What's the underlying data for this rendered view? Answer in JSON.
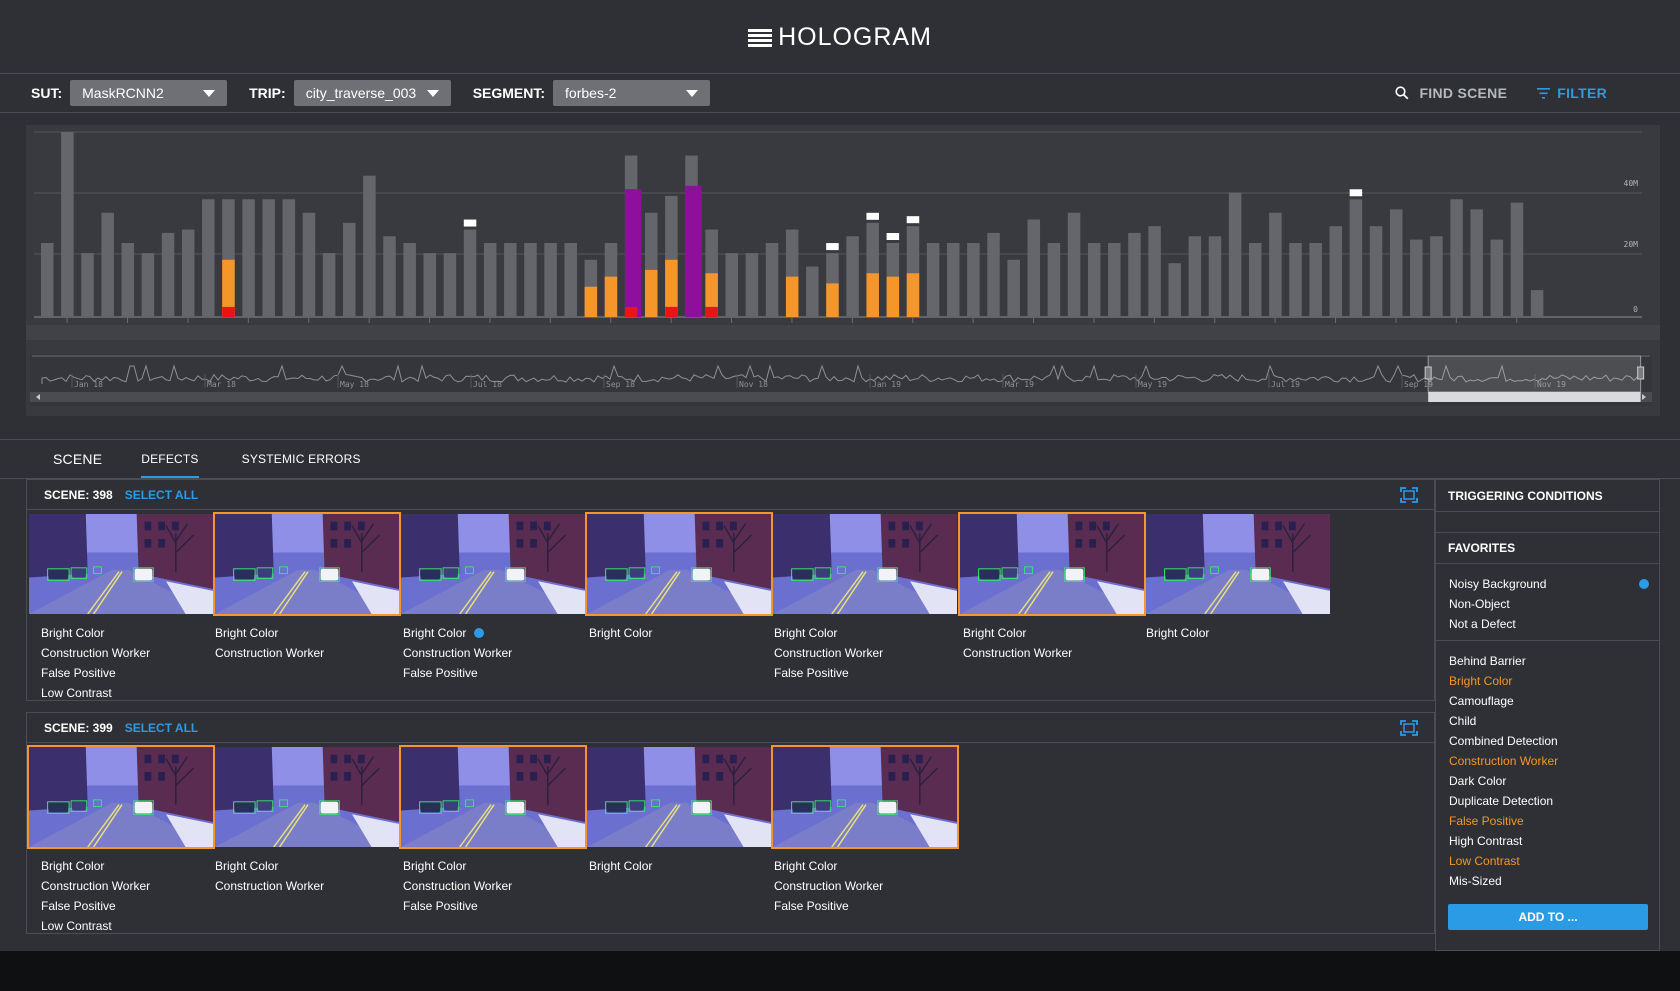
{
  "app": {
    "title": "HOLOGRAM"
  },
  "toolbar": {
    "sut_label": "SUT:",
    "sut_value": "MaskRCNN2",
    "trip_label": "TRIP:",
    "trip_value": "city_traverse_003",
    "segment_label": "SEGMENT:",
    "segment_value": "forbes-2",
    "find_label": "FIND SCENE",
    "filter_label": "FILTER"
  },
  "colors": {
    "accent": "#2b9be6",
    "defect": "#f5962a",
    "critical": "#e8141a",
    "systemic": "#8e0f9c",
    "bar": "#64666b"
  },
  "chart_data": {
    "type": "bar",
    "ylabels": [
      "40M",
      "20M",
      "0"
    ],
    "ylim": [
      0,
      55
    ],
    "series": [
      {
        "name": "total",
        "values": [
          22,
          55,
          19,
          31,
          22,
          19,
          25,
          26,
          35,
          35,
          35,
          35,
          35,
          31,
          19,
          28,
          42,
          24,
          22,
          19,
          19,
          26,
          22,
          22,
          22,
          22,
          22,
          17,
          22,
          48,
          31,
          36,
          48,
          26,
          19,
          19,
          22,
          26,
          15,
          19,
          24,
          28,
          22,
          27,
          22,
          22,
          22,
          25,
          17,
          29,
          22,
          31,
          22,
          22,
          25,
          27,
          16,
          24,
          24,
          37,
          22,
          31,
          22,
          22,
          27,
          35,
          27,
          32,
          23,
          24,
          35,
          32,
          23,
          34,
          8
        ]
      },
      {
        "name": "defect",
        "values": [
          0,
          0,
          0,
          0,
          0,
          0,
          0,
          0,
          0,
          17,
          0,
          0,
          0,
          0,
          0,
          0,
          0,
          0,
          0,
          0,
          0,
          0,
          0,
          0,
          0,
          0,
          0,
          9,
          12,
          0,
          14,
          17,
          0,
          13,
          0,
          0,
          0,
          12,
          0,
          10,
          0,
          13,
          12,
          13,
          0,
          0,
          0,
          0,
          0,
          0,
          0,
          0,
          0,
          0,
          0,
          0,
          0,
          0,
          0,
          0,
          0,
          0,
          0,
          0,
          0,
          0,
          0,
          0,
          0,
          0,
          0,
          0,
          0,
          0,
          0
        ]
      },
      {
        "name": "critical",
        "values": [
          0,
          0,
          0,
          0,
          0,
          0,
          0,
          0,
          0,
          3,
          0,
          0,
          0,
          0,
          0,
          0,
          0,
          0,
          0,
          0,
          0,
          0,
          0,
          0,
          0,
          0,
          0,
          0,
          0,
          3,
          0,
          3,
          0,
          3,
          0,
          0,
          0,
          0,
          0,
          0,
          0,
          0,
          0,
          0,
          0,
          0,
          0,
          0,
          0,
          0,
          0,
          0,
          0,
          0,
          0,
          0,
          0,
          0,
          0,
          0,
          0,
          0,
          0,
          0,
          0,
          0,
          0,
          0,
          0,
          0,
          0,
          0,
          0,
          0,
          0
        ]
      },
      {
        "name": "systemic",
        "values": [
          0,
          0,
          0,
          0,
          0,
          0,
          0,
          0,
          0,
          0,
          0,
          0,
          0,
          0,
          0,
          0,
          0,
          0,
          0,
          0,
          0,
          0,
          0,
          0,
          0,
          0,
          0,
          0,
          0,
          38,
          0,
          0,
          39,
          0,
          0,
          0,
          0,
          0,
          0,
          0,
          0,
          0,
          0,
          0,
          0,
          0,
          0,
          0,
          0,
          0,
          0,
          0,
          0,
          0,
          0,
          0,
          0,
          0,
          0,
          0,
          0,
          0,
          0,
          0,
          0,
          0,
          0,
          0,
          0,
          0,
          0,
          0,
          0,
          0,
          0
        ]
      },
      {
        "name": "flag",
        "values": [
          0,
          0,
          0,
          0,
          0,
          0,
          0,
          0,
          0,
          0,
          0,
          0,
          0,
          0,
          0,
          0,
          0,
          0,
          0,
          0,
          0,
          1,
          0,
          0,
          0,
          0,
          0,
          0,
          0,
          0,
          0,
          0,
          0,
          0,
          0,
          0,
          0,
          0,
          0,
          1,
          0,
          1,
          1,
          1,
          0,
          0,
          0,
          0,
          0,
          0,
          0,
          0,
          0,
          0,
          0,
          0,
          0,
          0,
          0,
          0,
          0,
          0,
          0,
          0,
          0,
          1,
          0,
          0,
          0,
          0,
          0,
          0,
          0,
          0,
          0
        ]
      }
    ],
    "timeline_labels": [
      "Jan 18",
      "Mar 18",
      "May 18",
      "Jul 18",
      "Sep 18",
      "Nov 18",
      "Jan 19",
      "Mar 19",
      "May 19",
      "Jul 19",
      "Sep 19",
      "Nov 19"
    ],
    "selection_range": [
      0.862,
      0.993
    ]
  },
  "tabs": [
    "SCENE",
    "DEFECTS",
    "SYSTEMIC ERRORS"
  ],
  "scenes": [
    {
      "title": "SCENE: 398",
      "select_all": "SELECT ALL",
      "thumbs": [
        {
          "selected": false,
          "tags": [
            "Bright Color",
            "Construction Worker",
            "False Positive",
            "Low Contrast"
          ]
        },
        {
          "selected": true,
          "tags": [
            "Bright Color",
            "Construction Worker"
          ]
        },
        {
          "selected": false,
          "tags": [
            "Bright Color",
            "Construction Worker",
            "False Positive"
          ],
          "favorite_dot": true
        },
        {
          "selected": true,
          "tags": [
            "Bright Color"
          ]
        },
        {
          "selected": false,
          "tags": [
            "Bright Color",
            "Construction Worker",
            "False Positive"
          ]
        },
        {
          "selected": true,
          "tags": [
            "Bright Color",
            "Construction Worker"
          ]
        },
        {
          "selected": false,
          "tags": [
            "Bright Color"
          ]
        }
      ]
    },
    {
      "title": "SCENE: 399",
      "select_all": "SELECT ALL",
      "thumbs": [
        {
          "selected": true,
          "tags": [
            "Bright Color",
            "Construction Worker",
            "False Positive",
            "Low Contrast"
          ]
        },
        {
          "selected": false,
          "tags": [
            "Bright Color",
            "Construction Worker"
          ]
        },
        {
          "selected": true,
          "tags": [
            "Bright Color",
            "Construction Worker",
            "False Positive"
          ]
        },
        {
          "selected": false,
          "tags": [
            "Bright Color"
          ]
        },
        {
          "selected": true,
          "tags": [
            "Bright Color",
            "Construction Worker",
            "False Positive"
          ]
        }
      ]
    }
  ],
  "sidebar": {
    "triggering_title": "TRIGGERING CONDITIONS",
    "favorites_title": "FAVORITES",
    "favorites": [
      "Noisy Background",
      "Non-Object",
      "Not a Defect"
    ],
    "conditions": [
      {
        "label": "Behind Barrier",
        "active": false
      },
      {
        "label": "Bright Color",
        "active": true
      },
      {
        "label": "Camouflage",
        "active": false
      },
      {
        "label": "Child",
        "active": false
      },
      {
        "label": "Combined Detection",
        "active": false
      },
      {
        "label": "Construction Worker",
        "active": true
      },
      {
        "label": "Dark Color",
        "active": false
      },
      {
        "label": "Duplicate Detection",
        "active": false
      },
      {
        "label": "False Positive",
        "active": true
      },
      {
        "label": "High Contrast",
        "active": false
      },
      {
        "label": "Low Contrast",
        "active": true
      },
      {
        "label": "Mis-Sized",
        "active": false
      }
    ],
    "add_button": "ADD TO ..."
  }
}
